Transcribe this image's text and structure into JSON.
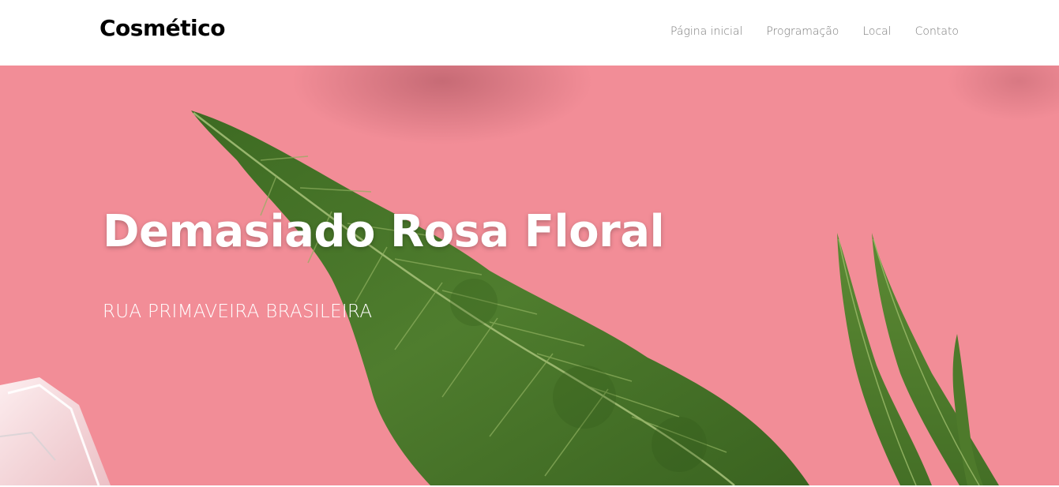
{
  "header": {
    "brand": "Cosmético",
    "nav": [
      {
        "label": "Página inicial"
      },
      {
        "label": "Programação"
      },
      {
        "label": "Local"
      },
      {
        "label": "Contato"
      }
    ]
  },
  "hero": {
    "title": "Demasiado Rosa Floral",
    "subtitle": "RUA PRIMAVEIRA BRASILEIRA",
    "background_color": "#f18c96",
    "leaf_color": "#4f7d2e"
  }
}
